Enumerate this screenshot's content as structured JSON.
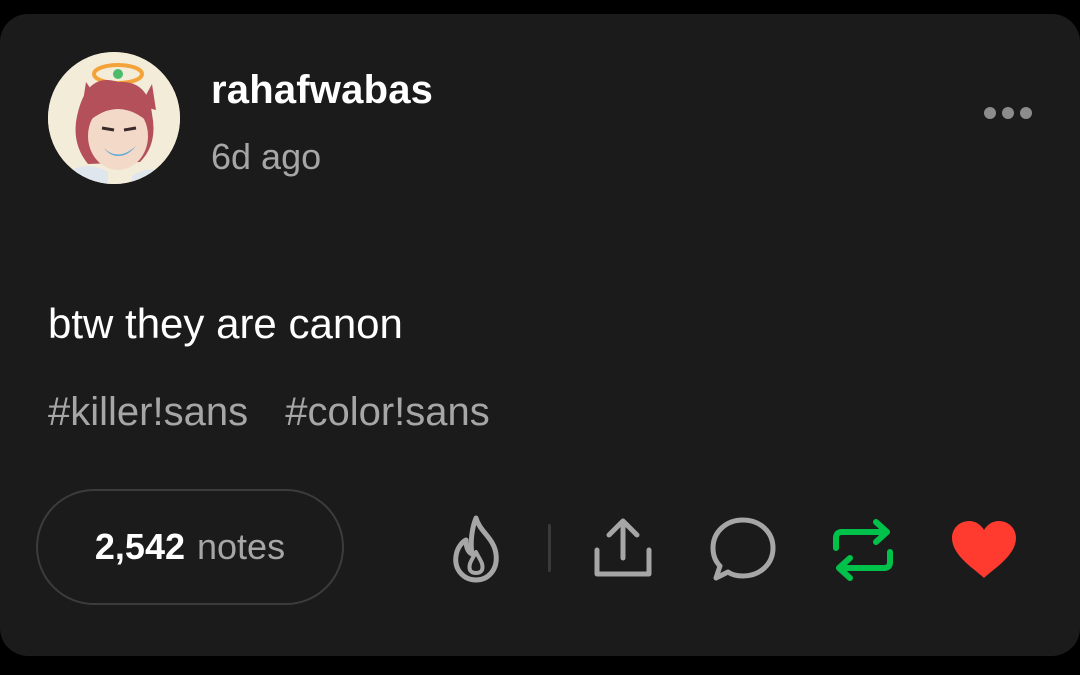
{
  "post": {
    "username": "rahafwabas",
    "timestamp": "6d ago",
    "body": "btw they are canon",
    "tags": [
      "#killer!sans",
      "#color!sans"
    ]
  },
  "footer": {
    "notes_count": "2,542",
    "notes_label": "notes"
  },
  "icons": {
    "more": "more-options-icon",
    "blaze": "flame-icon",
    "share": "share-icon",
    "reply": "reply-icon",
    "reblog": "reblog-icon",
    "like": "heart-icon"
  },
  "colors": {
    "card_background": "#1b1b1b",
    "reblog_active": "#00c24a",
    "like_active": "#ff3b30",
    "secondary_text": "#a6a6a6"
  }
}
